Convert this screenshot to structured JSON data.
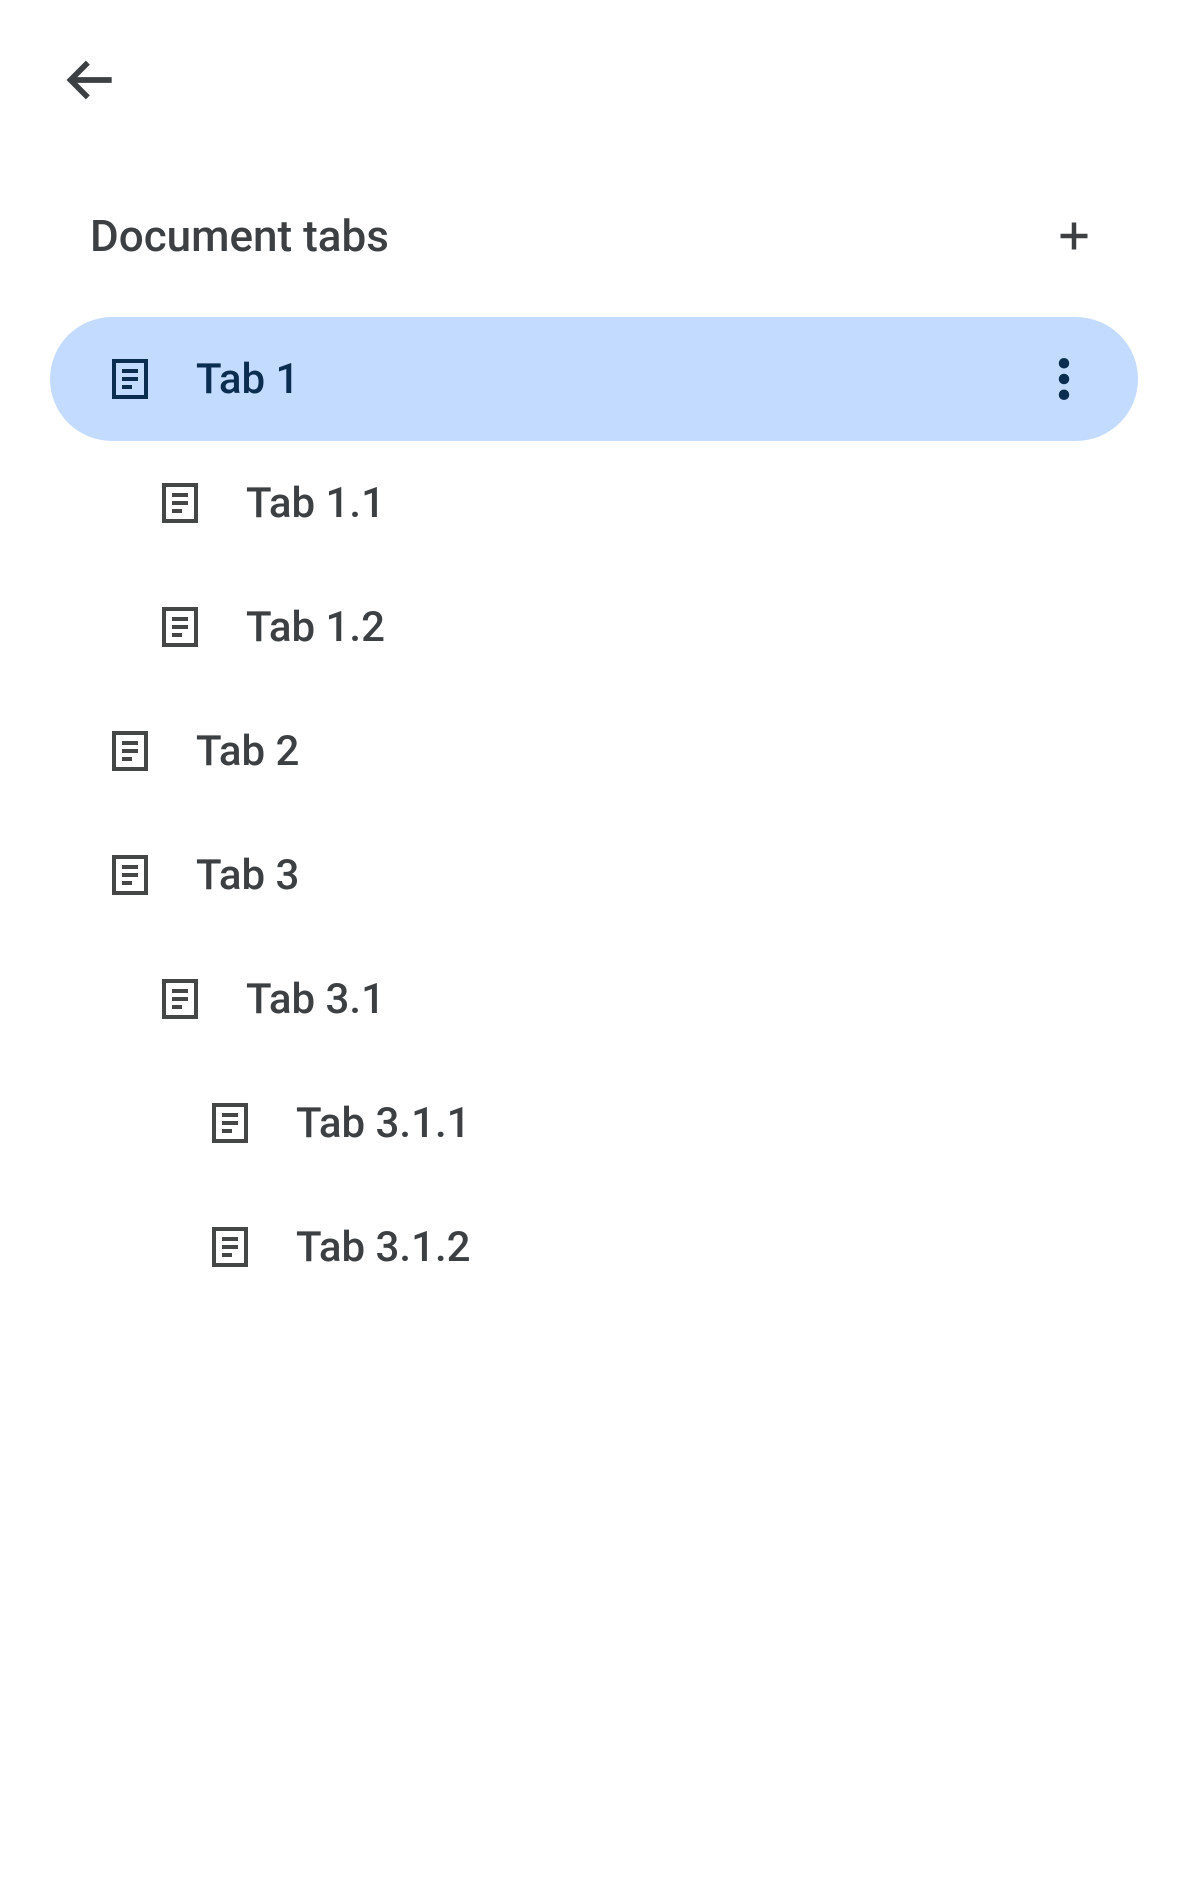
{
  "header": {
    "title": "Document tabs"
  },
  "tabs": [
    {
      "label": "Tab 1",
      "level": 0,
      "selected": true
    },
    {
      "label": "Tab 1.1",
      "level": 1,
      "selected": false
    },
    {
      "label": "Tab 1.2",
      "level": 1,
      "selected": false
    },
    {
      "label": "Tab 2",
      "level": 0,
      "selected": false
    },
    {
      "label": "Tab 3",
      "level": 0,
      "selected": false
    },
    {
      "label": "Tab 3.1",
      "level": 1,
      "selected": false
    },
    {
      "label": "Tab 3.1.1",
      "level": 2,
      "selected": false
    },
    {
      "label": "Tab 3.1.2",
      "level": 2,
      "selected": false
    }
  ],
  "colors": {
    "selected_bg": "#c3dbff",
    "selected_text": "#0b2d50",
    "text": "#3c4043",
    "icon": "#444746",
    "selected_icon": "#0b2d50",
    "more_dots": "#0b2d50"
  }
}
